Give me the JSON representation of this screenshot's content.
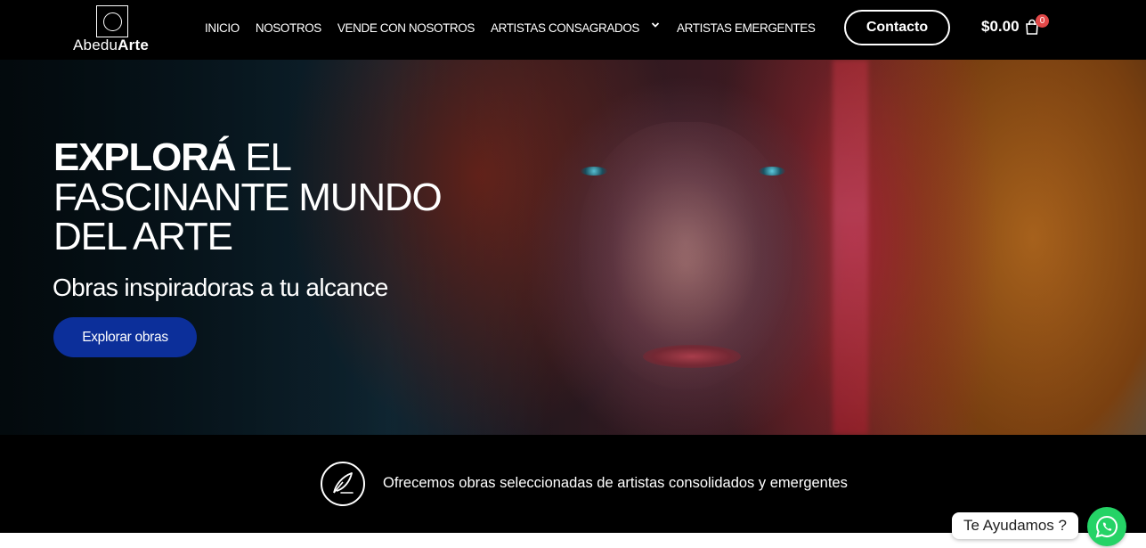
{
  "header": {
    "logo": {
      "text_regular": "Abedu",
      "text_bold": "Arte"
    },
    "nav": [
      {
        "label": "INICIO"
      },
      {
        "label": "NOSOTROS"
      },
      {
        "label": "VENDE CON NOSOTROS"
      },
      {
        "label": "ARTISTAS CONSAGRADOS",
        "has_dropdown": true
      },
      {
        "label": "ARTISTAS EMERGENTES"
      }
    ],
    "contact_label": "Contacto",
    "cart": {
      "amount": "$0.00",
      "count": "0",
      "icon": "shopping-bag-icon",
      "badge_color": "#e24848"
    }
  },
  "hero": {
    "title_strong": "EXPLORÁ",
    "title_rest_line1": " EL",
    "title_line2": "FASCINANTE MUNDO",
    "title_line3": "DEL ARTE",
    "subtitle": "Obras inspiradoras a tu alcance",
    "cta_label": "Explorar obras",
    "cta_color": "#0c2f9a"
  },
  "band": {
    "icon": "quill-pen-icon",
    "text": "Ofrecemos obras seleccionadas de artistas consolidados y emergentes"
  },
  "whatsapp": {
    "bubble_text": "Te Ayudamos ?",
    "icon": "whatsapp-icon",
    "color": "#25d366"
  }
}
